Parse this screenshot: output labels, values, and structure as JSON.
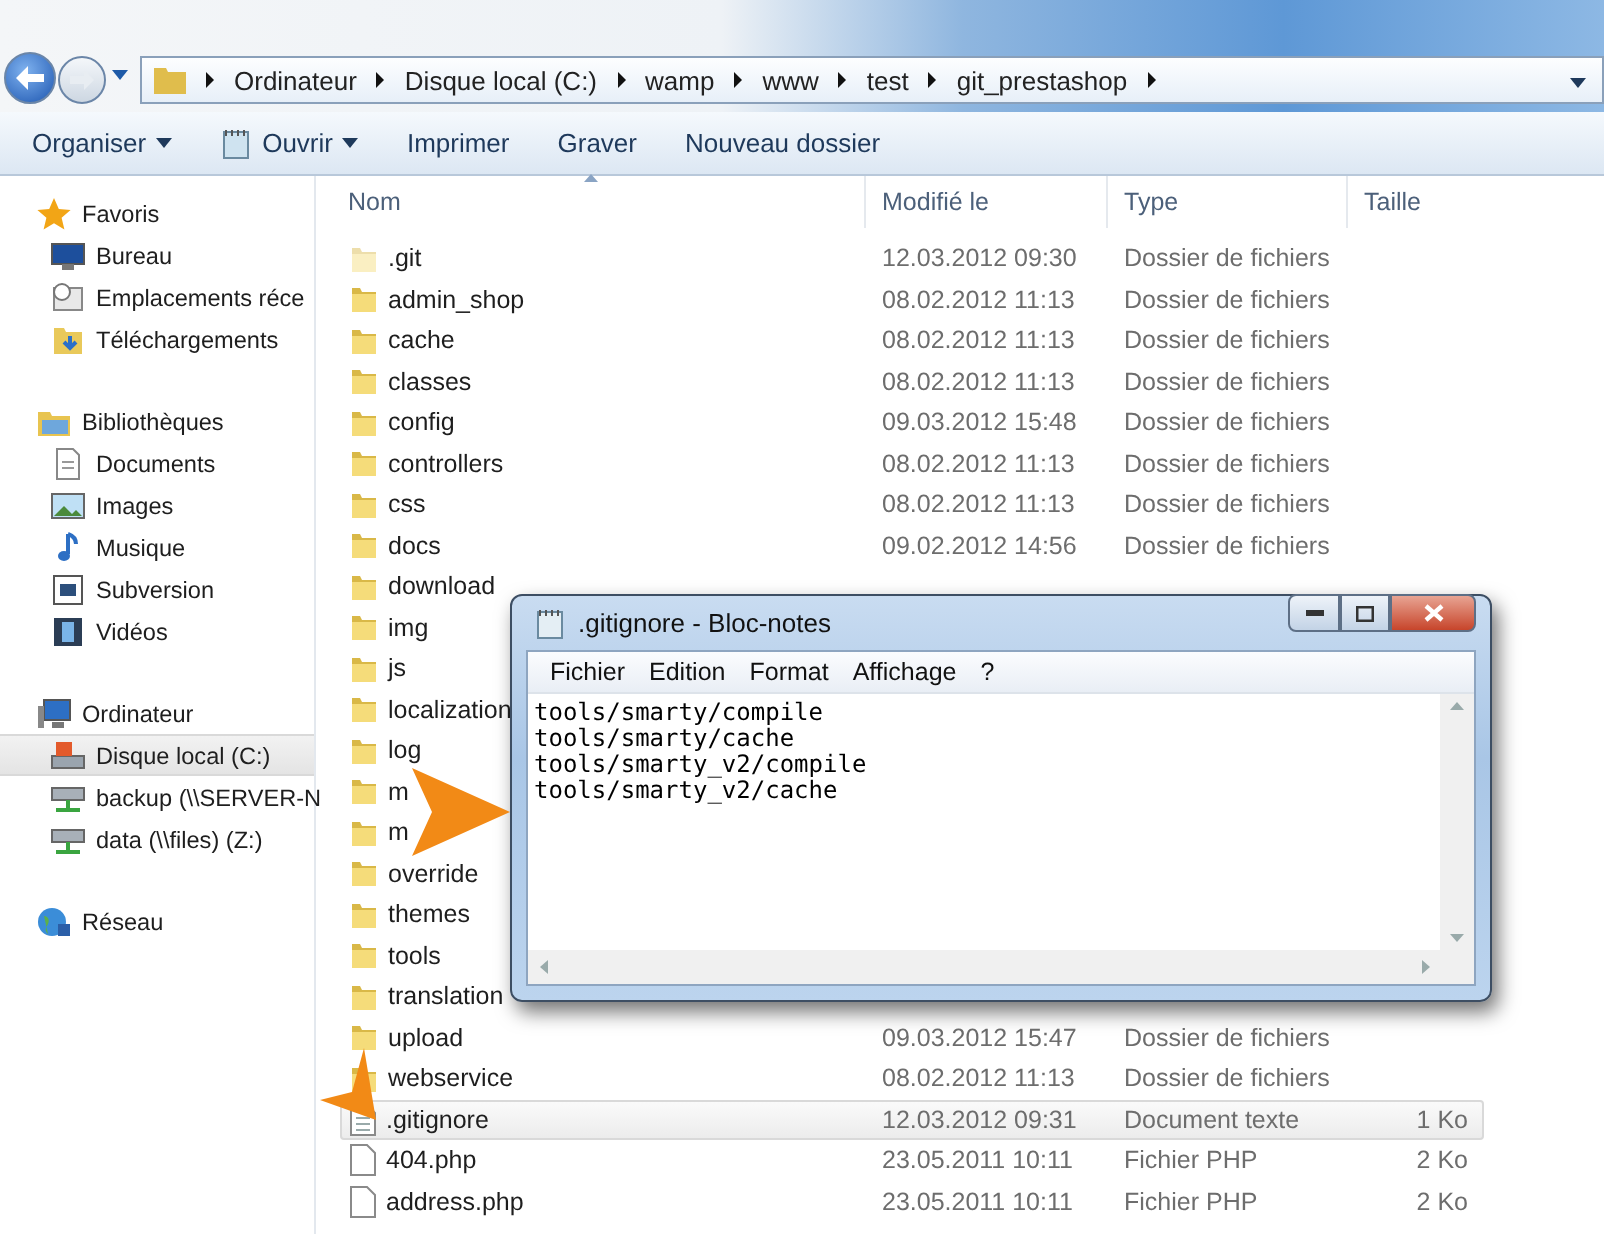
{
  "address_bar": {
    "segments": [
      "Ordinateur",
      "Disque local (C:)",
      "wamp",
      "www",
      "test",
      "git_prestashop"
    ]
  },
  "toolbar": [
    {
      "label": "Organiser",
      "dropdown": true,
      "kind": "plain"
    },
    {
      "label": "Ouvrir",
      "dropdown": true,
      "kind": "notepad"
    },
    {
      "label": "Imprimer",
      "dropdown": false,
      "kind": "plain"
    },
    {
      "label": "Graver",
      "dropdown": false,
      "kind": "plain"
    },
    {
      "label": "Nouveau dossier",
      "dropdown": false,
      "kind": "plain"
    }
  ],
  "sidebar": {
    "groups": [
      {
        "label": "Favoris",
        "kind": "star",
        "items": [
          {
            "label": "Bureau",
            "kind": "desktop",
            "selected": false
          },
          {
            "label": "Emplacements réce",
            "kind": "recent",
            "selected": false
          },
          {
            "label": "Téléchargements",
            "kind": "downloads",
            "selected": false
          }
        ]
      },
      {
        "label": "Bibliothèques",
        "kind": "library",
        "items": [
          {
            "label": "Documents",
            "kind": "document",
            "selected": false
          },
          {
            "label": "Images",
            "kind": "image",
            "selected": false
          },
          {
            "label": "Musique",
            "kind": "music",
            "selected": false
          },
          {
            "label": "Subversion",
            "kind": "app",
            "selected": false
          },
          {
            "label": "Vidéos",
            "kind": "video",
            "selected": false
          }
        ]
      },
      {
        "label": "Ordinateur",
        "kind": "computer",
        "items": [
          {
            "label": "Disque local (C:)",
            "kind": "drive",
            "selected": true
          },
          {
            "label": "backup (\\\\SERVER-N",
            "kind": "network",
            "selected": false
          },
          {
            "label": "data (\\\\files) (Z:)",
            "kind": "network",
            "selected": false
          }
        ]
      },
      {
        "label": "Réseau",
        "kind": "globe"
      }
    ]
  },
  "table": {
    "columns": [
      "Nom",
      "Modifié le",
      "Type",
      "Taille"
    ],
    "rows": [
      {
        "name": ".git",
        "kind": "hidden-folder",
        "modified": "12.03.2012 09:30",
        "type": "Dossier de fichiers",
        "selected": false
      },
      {
        "name": "admin_shop",
        "kind": "folder",
        "modified": "08.02.2012 11:13",
        "type": "Dossier de fichiers",
        "selected": false
      },
      {
        "name": "cache",
        "kind": "folder",
        "modified": "08.02.2012 11:13",
        "type": "Dossier de fichiers",
        "selected": false
      },
      {
        "name": "classes",
        "kind": "folder",
        "modified": "08.02.2012 11:13",
        "type": "Dossier de fichiers",
        "selected": false
      },
      {
        "name": "config",
        "kind": "folder",
        "modified": "09.03.2012 15:48",
        "type": "Dossier de fichiers",
        "selected": false
      },
      {
        "name": "controllers",
        "kind": "folder",
        "modified": "08.02.2012 11:13",
        "type": "Dossier de fichiers",
        "selected": false
      },
      {
        "name": "css",
        "kind": "folder",
        "modified": "08.02.2012 11:13",
        "type": "Dossier de fichiers",
        "selected": false
      },
      {
        "name": "docs",
        "kind": "folder",
        "modified": "09.02.2012 14:56",
        "type": "Dossier de fichiers",
        "selected": false
      },
      {
        "name": "download",
        "kind": "folder",
        "selected": false
      },
      {
        "name": "img",
        "kind": "folder",
        "selected": false
      },
      {
        "name": "js",
        "kind": "folder",
        "selected": false
      },
      {
        "name": "localization",
        "kind": "folder",
        "selected": false
      },
      {
        "name": "log",
        "kind": "folder",
        "selected": false
      },
      {
        "name": "m",
        "kind": "folder",
        "selected": false
      },
      {
        "name": "m",
        "kind": "folder",
        "selected": false
      },
      {
        "name": "override",
        "kind": "folder",
        "selected": false
      },
      {
        "name": "themes",
        "kind": "folder",
        "selected": false
      },
      {
        "name": "tools",
        "kind": "folder",
        "selected": false
      },
      {
        "name": "translation",
        "kind": "folder",
        "selected": false
      },
      {
        "name": "upload",
        "kind": "folder",
        "modified": "09.03.2012 15:47",
        "type": "Dossier de fichiers",
        "selected": false
      },
      {
        "name": "webservice",
        "kind": "folder",
        "modified": "08.02.2012 11:13",
        "type": "Dossier de fichiers",
        "selected": false
      },
      {
        "name": ".gitignore",
        "kind": "text-file",
        "modified": "12.03.2012 09:31",
        "type": "Document texte",
        "size": "1 Ko",
        "selected": true
      },
      {
        "name": "404.php",
        "kind": "file",
        "modified": "23.05.2011 10:11",
        "type": "Fichier PHP",
        "size": "2 Ko",
        "selected": false
      },
      {
        "name": "address.php",
        "kind": "file",
        "modified": "23.05.2011 10:11",
        "type": "Fichier PHP",
        "size": "2 Ko",
        "selected": false
      }
    ]
  },
  "notepad": {
    "title": ".gitignore - Bloc-notes",
    "menu": [
      "Fichier",
      "Edition",
      "Format",
      "Affichage",
      "?"
    ],
    "lines": [
      "tools/smarty/compile",
      "tools/smarty/cache",
      "tools/smarty_v2/compile",
      "tools/smarty_v2/cache"
    ]
  }
}
